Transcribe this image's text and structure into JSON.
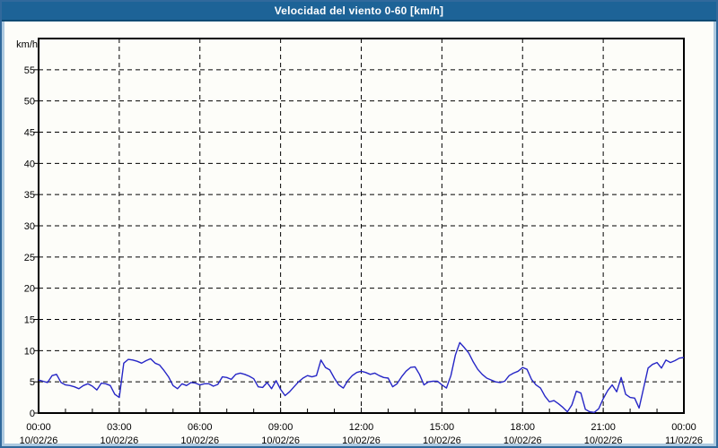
{
  "window": {
    "title": "Velocidad del viento 0-60 [km/h]"
  },
  "colors": {
    "title_bar": "#1d6397",
    "title_text": "#ffffff",
    "frame": "#adc9e0",
    "frame_border": "#31699c",
    "plot_background": "#fdfdf9",
    "axis": "#000000",
    "grid": "#000000",
    "series_line": "#2626c6"
  },
  "chart_data": {
    "type": "line",
    "title": "Velocidad del viento 0-60 [km/h]",
    "y_unit_label": "km/h",
    "ylim": [
      0,
      60
    ],
    "y_tick_step": 5,
    "y_ticks": [
      0,
      5,
      10,
      15,
      20,
      25,
      30,
      35,
      40,
      45,
      50,
      55
    ],
    "grid": "dashed",
    "x_span_hours": 24,
    "x_minor_tick_hours": 1,
    "x_ticks": [
      {
        "hour": 0,
        "time": "00:00",
        "date": "10/02/26"
      },
      {
        "hour": 3,
        "time": "03:00",
        "date": "10/02/26"
      },
      {
        "hour": 6,
        "time": "06:00",
        "date": "10/02/26"
      },
      {
        "hour": 9,
        "time": "09:00",
        "date": "10/02/26"
      },
      {
        "hour": 12,
        "time": "12:00",
        "date": "10/02/26"
      },
      {
        "hour": 15,
        "time": "15:00",
        "date": "10/02/26"
      },
      {
        "hour": 18,
        "time": "18:00",
        "date": "10/02/26"
      },
      {
        "hour": 21,
        "time": "21:00",
        "date": "10/02/26"
      },
      {
        "hour": 24,
        "time": "00:00",
        "date": "11/02/26"
      }
    ],
    "sample_interval_minutes": 10,
    "series": [
      {
        "name": "Velocidad del viento",
        "color": "#2626c6",
        "values": [
          5.3,
          5.1,
          4.9,
          6.0,
          6.2,
          4.9,
          4.5,
          4.4,
          4.2,
          3.9,
          4.4,
          4.7,
          4.3,
          3.7,
          4.8,
          4.7,
          4.4,
          3.0,
          2.5,
          8.0,
          8.6,
          8.5,
          8.3,
          8.0,
          8.4,
          8.7,
          8.0,
          7.7,
          6.8,
          5.8,
          4.4,
          3.9,
          4.7,
          4.4,
          4.9,
          4.8,
          4.5,
          4.7,
          4.7,
          4.3,
          4.6,
          5.8,
          5.7,
          5.4,
          6.2,
          6.4,
          6.2,
          5.9,
          5.5,
          4.2,
          4.1,
          4.9,
          3.9,
          5.2,
          3.8,
          2.8,
          3.4,
          4.2,
          5.0,
          5.6,
          6.0,
          5.8,
          6.0,
          8.5,
          7.3,
          6.9,
          5.6,
          4.5,
          4.0,
          5.2,
          6.0,
          6.5,
          6.7,
          6.5,
          6.2,
          6.4,
          6.0,
          5.7,
          5.6,
          4.2,
          4.7,
          5.8,
          6.7,
          7.3,
          7.4,
          6.2,
          4.5,
          5.0,
          5.1,
          5.1,
          4.5,
          4.0,
          6.0,
          9.3,
          11.3,
          10.5,
          9.6,
          8.2,
          7.0,
          6.2,
          5.6,
          5.3,
          5.0,
          4.9,
          5.1,
          6.0,
          6.4,
          6.7,
          7.3,
          7.0,
          5.4,
          4.5,
          4.0,
          2.7,
          1.8,
          2.0,
          1.5,
          0.9,
          0.2,
          1.3,
          3.5,
          3.2,
          0.6,
          0.2,
          0.1,
          0.7,
          2.3,
          3.6,
          4.5,
          3.4,
          5.7,
          3.0,
          2.5,
          2.4,
          0.8,
          4.0,
          7.2,
          7.8,
          8.1,
          7.2,
          8.5,
          8.1,
          8.4,
          8.8,
          8.9
        ]
      }
    ]
  }
}
